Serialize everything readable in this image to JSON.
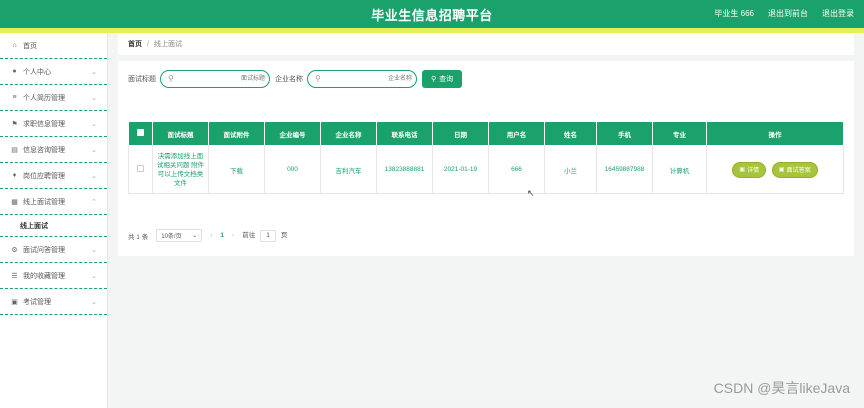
{
  "header": {
    "title": "毕业生信息招聘平台",
    "user": "毕业生 666",
    "back_link": "退出到前台",
    "logout_link": "退出登录"
  },
  "sidebar": {
    "items": [
      {
        "label": "首页",
        "icon": "home-icon",
        "glyph": "⌂"
      },
      {
        "label": "个人中心",
        "icon": "user-icon",
        "glyph": "●"
      },
      {
        "label": "个人简历管理",
        "icon": "list-icon",
        "glyph": "≡"
      },
      {
        "label": "求职信息管理",
        "icon": "flag-icon",
        "glyph": "⚑"
      },
      {
        "label": "信息咨询管理",
        "icon": "document-icon",
        "glyph": "▤"
      },
      {
        "label": "岗位应聘管理",
        "icon": "mic-icon",
        "glyph": "♦"
      }
    ],
    "expanded": {
      "label": "线上面试管理",
      "icon": "grid-icon",
      "glyph": "▦",
      "sub": "线上面试"
    },
    "items_after": [
      {
        "label": "面试问答管理",
        "icon": "settings-icon",
        "glyph": "⚙"
      },
      {
        "label": "我的收藏管理",
        "icon": "sliders-icon",
        "glyph": "☰"
      },
      {
        "label": "考试管理",
        "icon": "briefcase-icon",
        "glyph": "▣"
      }
    ]
  },
  "breadcrumb": {
    "home": "首页",
    "sep": "/",
    "current": "线上面试"
  },
  "search": {
    "label1": "面试标题",
    "placeholder1": "面试标题",
    "label2": "企业名称",
    "placeholder2": "企业名称",
    "button": "查询"
  },
  "table": {
    "headers": [
      "面试标题",
      "面试附件",
      "企业编号",
      "企业名称",
      "联系电话",
      "日期",
      "用户名",
      "姓名",
      "手机",
      "专业",
      "操作"
    ],
    "rows": [
      {
        "title": "决需添加线上面试相关问题 附件可以上传文档类文件",
        "attachment": "下载",
        "company_no": "000",
        "company_name": "吉利汽车",
        "phone": "13823888881",
        "date": "2021-01-19",
        "username": "666",
        "name": "小兰",
        "mobile": "16459887988",
        "major": "计算机",
        "actions": [
          "详情",
          "面试答案"
        ]
      }
    ]
  },
  "pager": {
    "total": "共 1 条",
    "size": "10条/页",
    "page": "1",
    "goto_prefix": "前往",
    "goto_value": "1",
    "goto_suffix": "页"
  },
  "watermark": "CSDN @昊言likeJava",
  "colors": {
    "primary": "#1aa16c",
    "stripe": "#e8ef52",
    "action": "#a7c53a"
  }
}
